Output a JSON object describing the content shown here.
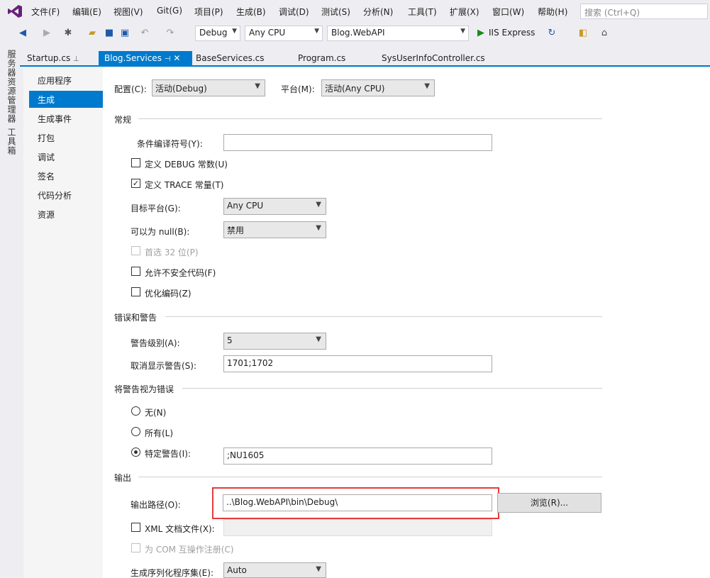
{
  "menu": [
    "文件(F)",
    "编辑(E)",
    "视图(V)",
    "Git(G)",
    "项目(P)",
    "生成(B)",
    "调试(D)",
    "测试(S)",
    "分析(N)",
    "工具(T)",
    "扩展(X)",
    "窗口(W)",
    "帮助(H)"
  ],
  "search": {
    "placeholder": "搜索 (Ctrl+Q)"
  },
  "toolbar": {
    "config": "Debug",
    "platform": "Any CPU",
    "project": "Blog.WebAPI",
    "run": "IIS Express"
  },
  "sidestrip": {
    "server_explorer": "服务器资源管理器",
    "toolbox": "工具箱"
  },
  "tabs": [
    "Startup.cs",
    "Blog.Services",
    "BaseServices.cs",
    "Program.cs",
    "SysUserInfoController.cs"
  ],
  "nav": [
    "应用程序",
    "生成",
    "生成事件",
    "打包",
    "调试",
    "签名",
    "代码分析",
    "资源"
  ],
  "top": {
    "config_label": "配置(C):",
    "config_value": "活动(Debug)",
    "platform_label": "平台(M):",
    "platform_value": "活动(Any CPU)"
  },
  "general": {
    "title": "常规",
    "symbols_label": "条件编译符号(Y):",
    "symbols_value": "",
    "define_debug": "定义 DEBUG 常数(U)",
    "define_trace": "定义 TRACE 常量(T)",
    "target_label": "目标平台(G):",
    "target_value": "Any CPU",
    "nullable_label": "可以为 null(B):",
    "nullable_value": "禁用",
    "prefer32": "首选 32 位(P)",
    "unsafe": "允许不安全代码(F)",
    "optimize": "优化编码(Z)"
  },
  "errors": {
    "title": "错误和警告",
    "level_label": "警告级别(A):",
    "level_value": "5",
    "suppress_label": "取消显示警告(S):",
    "suppress_value": "1701;1702"
  },
  "treat": {
    "title": "将警告视为错误",
    "none": "无(N)",
    "all": "所有(L)",
    "specific": "特定警告(I):",
    "specific_value": ";NU1605"
  },
  "output": {
    "title": "输出",
    "path_label": "输出路径(O):",
    "path_value": "..\\Blog.WebAPI\\bin\\Debug\\",
    "browse": "浏览(R)...",
    "xml_doc": "XML 文档文件(X):",
    "com": "为 COM 互操作注册(C)",
    "serialization_label": "生成序列化程序集(E):",
    "serialization_value": "Auto"
  },
  "colors": {
    "accent": "#007acc",
    "highlight": "#e53b3b"
  }
}
